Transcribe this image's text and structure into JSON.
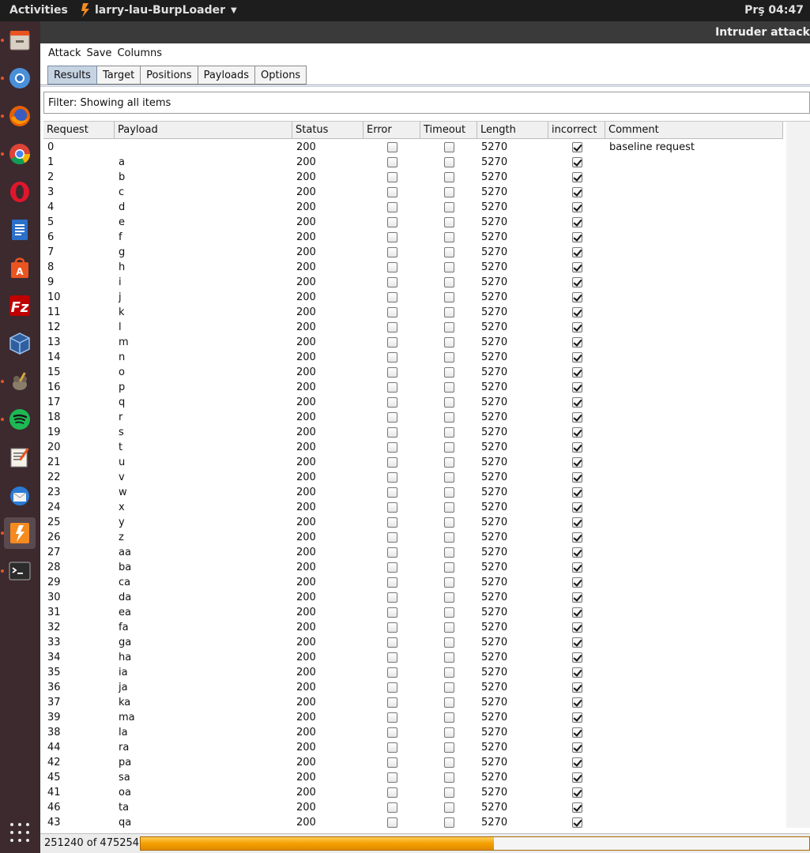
{
  "topbar": {
    "activities": "Activities",
    "app_name": "larry-lau-BurpLoader",
    "clock": "Prş 04:47"
  },
  "dock": {
    "items": [
      {
        "icon": "files-icon",
        "running": true
      },
      {
        "icon": "chromium-icon",
        "running": true
      },
      {
        "icon": "firefox-icon",
        "running": true
      },
      {
        "icon": "chrome-icon",
        "running": true
      },
      {
        "icon": "opera-icon",
        "running": false
      },
      {
        "icon": "writer-icon",
        "running": false
      },
      {
        "icon": "software-center-icon",
        "running": false
      },
      {
        "icon": "filezilla-icon",
        "running": false
      },
      {
        "icon": "virtualbox-icon",
        "running": false
      },
      {
        "icon": "gimp-icon",
        "running": true
      },
      {
        "icon": "spotify-icon",
        "running": true
      },
      {
        "icon": "text-editor-icon",
        "running": false
      },
      {
        "icon": "thunderbird-icon",
        "running": false
      },
      {
        "icon": "burp-icon",
        "running": true,
        "active": true
      },
      {
        "icon": "terminal-icon",
        "running": true
      }
    ]
  },
  "window": {
    "title": "Intruder attack",
    "menu": [
      "Attack",
      "Save",
      "Columns"
    ],
    "tabs": [
      {
        "label": "Results",
        "selected": true
      },
      {
        "label": "Target",
        "selected": false
      },
      {
        "label": "Positions",
        "selected": false
      },
      {
        "label": "Payloads",
        "selected": false
      },
      {
        "label": "Options",
        "selected": false
      }
    ],
    "filter": "Filter: Showing all items"
  },
  "table": {
    "columns": [
      "Request",
      "Payload",
      "Status",
      "Error",
      "Timeout",
      "Length",
      "incorrect",
      "Comment"
    ],
    "rows": [
      [
        "0",
        "",
        "200",
        false,
        false,
        "5270",
        true,
        "baseline request"
      ],
      [
        "1",
        "a",
        "200",
        false,
        false,
        "5270",
        true,
        ""
      ],
      [
        "2",
        "b",
        "200",
        false,
        false,
        "5270",
        true,
        ""
      ],
      [
        "3",
        "c",
        "200",
        false,
        false,
        "5270",
        true,
        ""
      ],
      [
        "4",
        "d",
        "200",
        false,
        false,
        "5270",
        true,
        ""
      ],
      [
        "5",
        "e",
        "200",
        false,
        false,
        "5270",
        true,
        ""
      ],
      [
        "6",
        "f",
        "200",
        false,
        false,
        "5270",
        true,
        ""
      ],
      [
        "7",
        "g",
        "200",
        false,
        false,
        "5270",
        true,
        ""
      ],
      [
        "8",
        "h",
        "200",
        false,
        false,
        "5270",
        true,
        ""
      ],
      [
        "9",
        "i",
        "200",
        false,
        false,
        "5270",
        true,
        ""
      ],
      [
        "10",
        "j",
        "200",
        false,
        false,
        "5270",
        true,
        ""
      ],
      [
        "11",
        "k",
        "200",
        false,
        false,
        "5270",
        true,
        ""
      ],
      [
        "12",
        "l",
        "200",
        false,
        false,
        "5270",
        true,
        ""
      ],
      [
        "13",
        "m",
        "200",
        false,
        false,
        "5270",
        true,
        ""
      ],
      [
        "14",
        "n",
        "200",
        false,
        false,
        "5270",
        true,
        ""
      ],
      [
        "15",
        "o",
        "200",
        false,
        false,
        "5270",
        true,
        ""
      ],
      [
        "16",
        "p",
        "200",
        false,
        false,
        "5270",
        true,
        ""
      ],
      [
        "17",
        "q",
        "200",
        false,
        false,
        "5270",
        true,
        ""
      ],
      [
        "18",
        "r",
        "200",
        false,
        false,
        "5270",
        true,
        ""
      ],
      [
        "19",
        "s",
        "200",
        false,
        false,
        "5270",
        true,
        ""
      ],
      [
        "20",
        "t",
        "200",
        false,
        false,
        "5270",
        true,
        ""
      ],
      [
        "21",
        "u",
        "200",
        false,
        false,
        "5270",
        true,
        ""
      ],
      [
        "22",
        "v",
        "200",
        false,
        false,
        "5270",
        true,
        ""
      ],
      [
        "23",
        "w",
        "200",
        false,
        false,
        "5270",
        true,
        ""
      ],
      [
        "24",
        "x",
        "200",
        false,
        false,
        "5270",
        true,
        ""
      ],
      [
        "25",
        "y",
        "200",
        false,
        false,
        "5270",
        true,
        ""
      ],
      [
        "26",
        "z",
        "200",
        false,
        false,
        "5270",
        true,
        ""
      ],
      [
        "27",
        "aa",
        "200",
        false,
        false,
        "5270",
        true,
        ""
      ],
      [
        "28",
        "ba",
        "200",
        false,
        false,
        "5270",
        true,
        ""
      ],
      [
        "29",
        "ca",
        "200",
        false,
        false,
        "5270",
        true,
        ""
      ],
      [
        "30",
        "da",
        "200",
        false,
        false,
        "5270",
        true,
        ""
      ],
      [
        "31",
        "ea",
        "200",
        false,
        false,
        "5270",
        true,
        ""
      ],
      [
        "32",
        "fa",
        "200",
        false,
        false,
        "5270",
        true,
        ""
      ],
      [
        "33",
        "ga",
        "200",
        false,
        false,
        "5270",
        true,
        ""
      ],
      [
        "34",
        "ha",
        "200",
        false,
        false,
        "5270",
        true,
        ""
      ],
      [
        "35",
        "ia",
        "200",
        false,
        false,
        "5270",
        true,
        ""
      ],
      [
        "36",
        "ja",
        "200",
        false,
        false,
        "5270",
        true,
        ""
      ],
      [
        "37",
        "ka",
        "200",
        false,
        false,
        "5270",
        true,
        ""
      ],
      [
        "39",
        "ma",
        "200",
        false,
        false,
        "5270",
        true,
        ""
      ],
      [
        "38",
        "la",
        "200",
        false,
        false,
        "5270",
        true,
        ""
      ],
      [
        "44",
        "ra",
        "200",
        false,
        false,
        "5270",
        true,
        ""
      ],
      [
        "42",
        "pa",
        "200",
        false,
        false,
        "5270",
        true,
        ""
      ],
      [
        "45",
        "sa",
        "200",
        false,
        false,
        "5270",
        true,
        ""
      ],
      [
        "41",
        "oa",
        "200",
        false,
        false,
        "5270",
        true,
        ""
      ],
      [
        "46",
        "ta",
        "200",
        false,
        false,
        "5270",
        true,
        ""
      ],
      [
        "43",
        "qa",
        "200",
        false,
        false,
        "5270",
        true,
        ""
      ]
    ]
  },
  "status": {
    "text": "251240 of 475254",
    "progress": 0.5287
  }
}
